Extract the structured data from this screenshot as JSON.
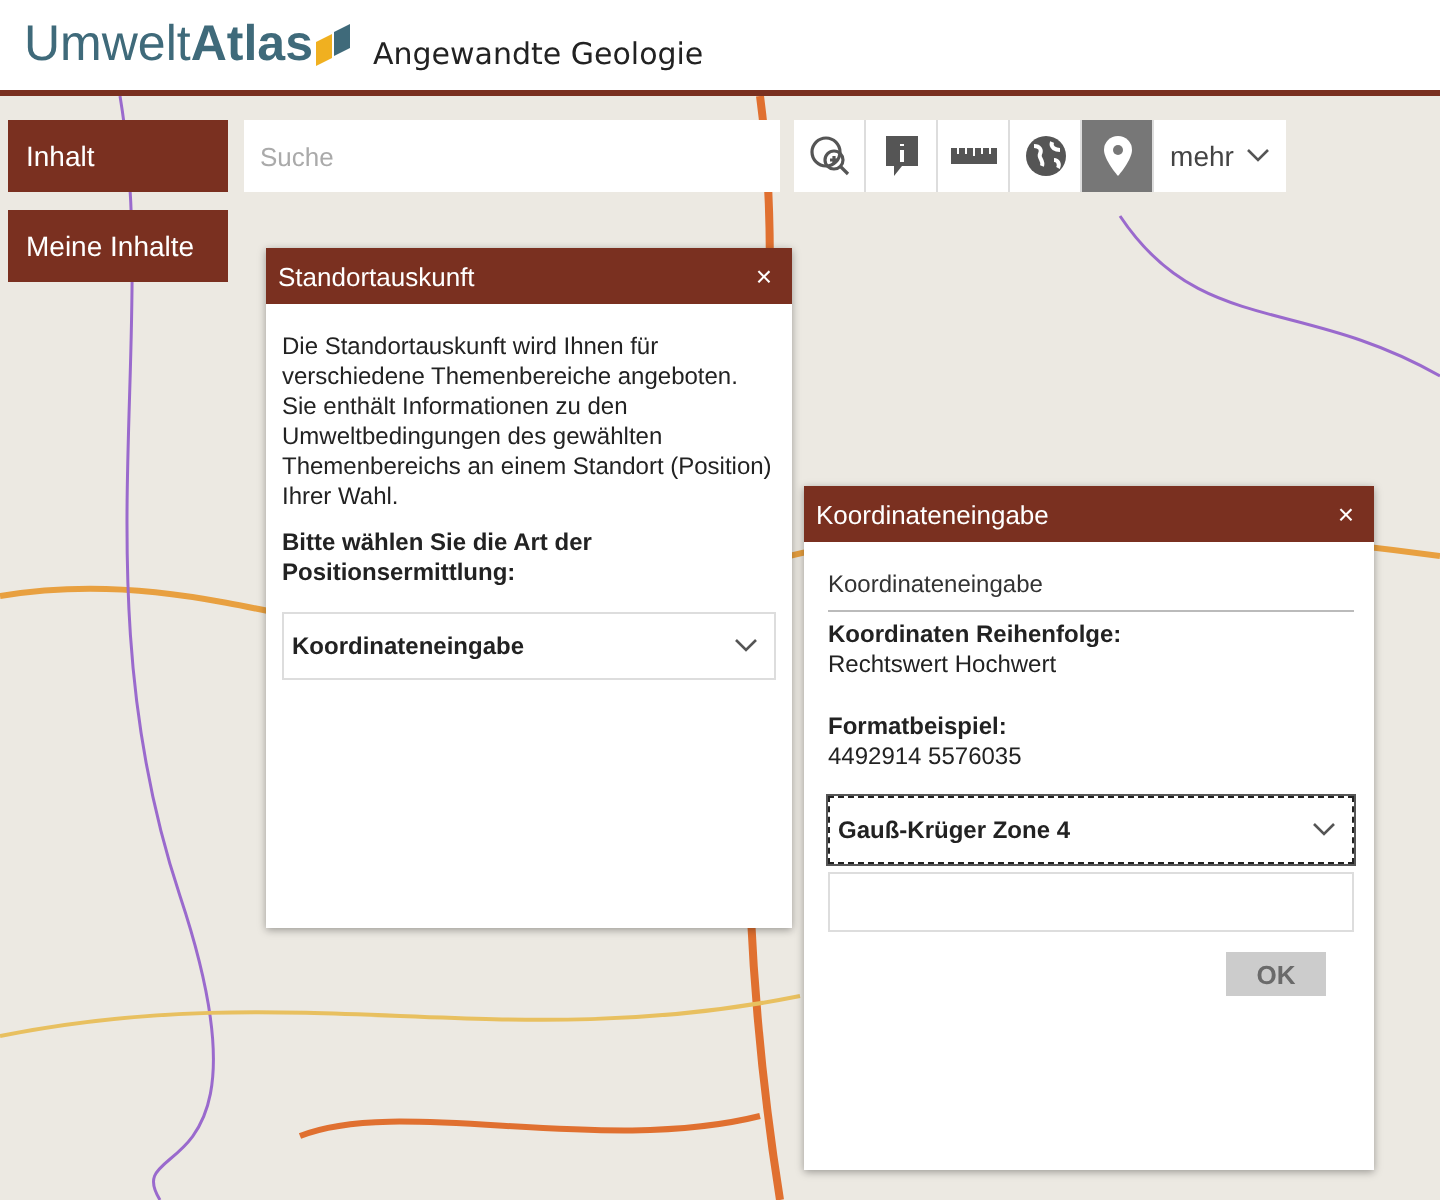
{
  "header": {
    "logo": {
      "part_1": "Umwelt",
      "part_2": "Atlas"
    },
    "title": "Angewandte Geologie"
  },
  "side_buttons": [
    {
      "label": "Inhalt"
    },
    {
      "label": "Meine Inhalte"
    }
  ],
  "search": {
    "placeholder": "Suche"
  },
  "tools": [
    {
      "kind": "zoom",
      "selected": false
    },
    {
      "kind": "info",
      "selected": false
    },
    {
      "kind": "ruler",
      "selected": false
    },
    {
      "kind": "globe",
      "selected": false
    },
    {
      "kind": "pin",
      "selected": true
    }
  ],
  "more_button": {
    "label": "mehr"
  },
  "location_dialog": {
    "title": "Standortauskunft",
    "close": "×",
    "text": "Die Standortauskunft wird Ihnen für verschiedene Themenbereiche angeboten. Sie enthält Informationen zu den Umweltbedingungen des gewählten Themenbereichs an einem Standort (Position) Ihrer Wahl.",
    "prompt": "Bitte wählen Sie die Art der Positionsermittlung:",
    "select": {
      "value": "Koordinateneingabe"
    }
  },
  "coordinate_dialog": {
    "title": "Koordinateneingabe",
    "close": "×",
    "subtitle": "Koordinateneingabe",
    "order_label": "Koordinaten Reihenfolge:",
    "order_value": "Rechtswert Hochwert",
    "example_label": "Formatbeispiel:",
    "example_value": "4492914 5576035",
    "select": {
      "value": "Gauß-Krüger Zone 4",
      "focused": true
    },
    "ok_button": {
      "label": "OK",
      "disabled": true
    }
  }
}
